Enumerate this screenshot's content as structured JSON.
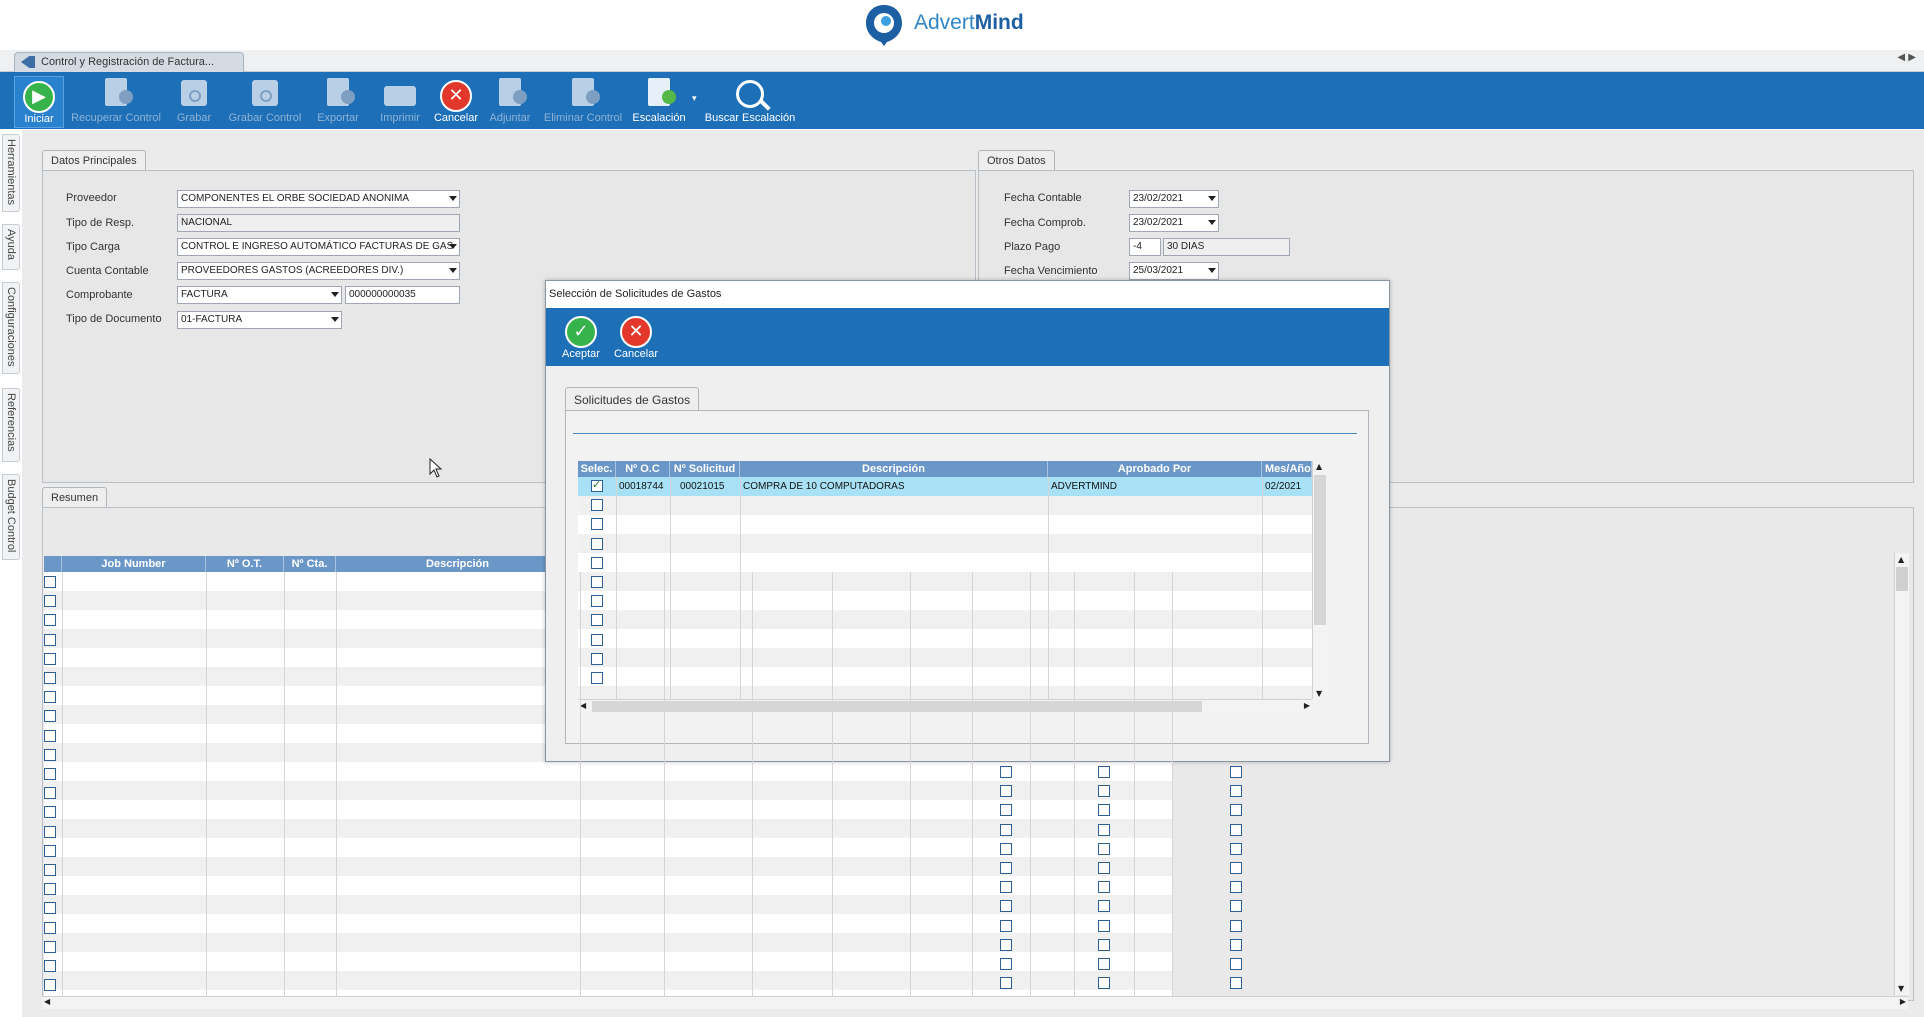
{
  "brand": {
    "name_light": "Advert",
    "name_bold": "Mind"
  },
  "document_tab": {
    "label": "Control y Registración de Factura..."
  },
  "toolbar": {
    "items": [
      {
        "label": "Iniciar",
        "icon": "play-icon",
        "enabled": true
      },
      {
        "label": "Recuperar Control",
        "icon": "recover-document-icon",
        "enabled": false
      },
      {
        "label": "Grabar",
        "icon": "save-icon",
        "enabled": false
      },
      {
        "label": "Grabar Control",
        "icon": "save-control-icon",
        "enabled": false
      },
      {
        "label": "Exportar",
        "icon": "export-icon",
        "enabled": false
      },
      {
        "label": "Imprimir",
        "icon": "print-icon",
        "enabled": false
      },
      {
        "label": "Cancelar",
        "icon": "cancel-icon",
        "enabled": true
      },
      {
        "label": "Adjuntar",
        "icon": "attach-icon",
        "enabled": false
      },
      {
        "label": "Eliminar Control",
        "icon": "delete-control-icon",
        "enabled": false
      },
      {
        "label": "Escalación",
        "icon": "escalation-icon",
        "enabled": true
      },
      {
        "label": "Buscar Escalación",
        "icon": "search-icon",
        "enabled": true
      }
    ]
  },
  "side_tabs": [
    "Herramientas",
    "Ayuda",
    "Configuraciones",
    "Referencias",
    "Budget Control"
  ],
  "datos_principales": {
    "tab": "Datos Principales",
    "fields": {
      "proveedor": {
        "label": "Proveedor",
        "value": "COMPONENTES EL ORBE SOCIEDAD ANONIMA"
      },
      "tipo_resp": {
        "label": "Tipo de Resp.",
        "value": "NACIONAL"
      },
      "tipo_carga": {
        "label": "Tipo Carga",
        "value": "CONTROL E INGRESO AUTOMÁTICO FACTURAS DE GAS"
      },
      "cuenta_contable": {
        "label": "Cuenta Contable",
        "value": "PROVEEDORES GASTOS (ACREEDORES DIV.)"
      },
      "comprobante": {
        "label": "Comprobante",
        "value": "FACTURA",
        "number": "000000000035"
      },
      "tipo_documento": {
        "label": "Tipo de Documento",
        "value": "01-FACTURA"
      }
    }
  },
  "otros_datos": {
    "tab": "Otros Datos",
    "fields": {
      "fecha_contable": {
        "label": "Fecha Contable",
        "value": "23/02/2021"
      },
      "fecha_comprob": {
        "label": "Fecha Comprob.",
        "value": "23/02/2021"
      },
      "plazo_pago": {
        "label": "Plazo Pago",
        "value": "-4",
        "text": "30 DIAS"
      },
      "fecha_vencimiento": {
        "label": "Fecha Vencimiento",
        "value": "25/03/2021"
      }
    }
  },
  "resumen": {
    "tab": "Resumen",
    "columns": [
      "Job Number",
      "Nº O.T.",
      "Nº Cta.",
      "Descripción"
    ]
  },
  "modal": {
    "title": "Selección de Solicitudes de Gastos",
    "accept_label": "Aceptar",
    "cancel_label": "Cancelar",
    "tab": "Solicitudes de Gastos",
    "columns": [
      "Selec.",
      "Nº O.C",
      "Nº Solicitud",
      "Descripción",
      "Aprobado Por",
      "Mes/Año"
    ],
    "rows": [
      {
        "selected": true,
        "oc": "00018744",
        "solicitud": "00021015",
        "descripcion": "COMPRA DE 10 COMPUTADORAS",
        "aprobado_por": "ADVERTMIND",
        "mes_anio": "02/2021"
      }
    ]
  },
  "colors": {
    "toolbar": "#1d6fb8",
    "grid_header": "#6b97c8",
    "selected_row": "#a8e1f5"
  }
}
